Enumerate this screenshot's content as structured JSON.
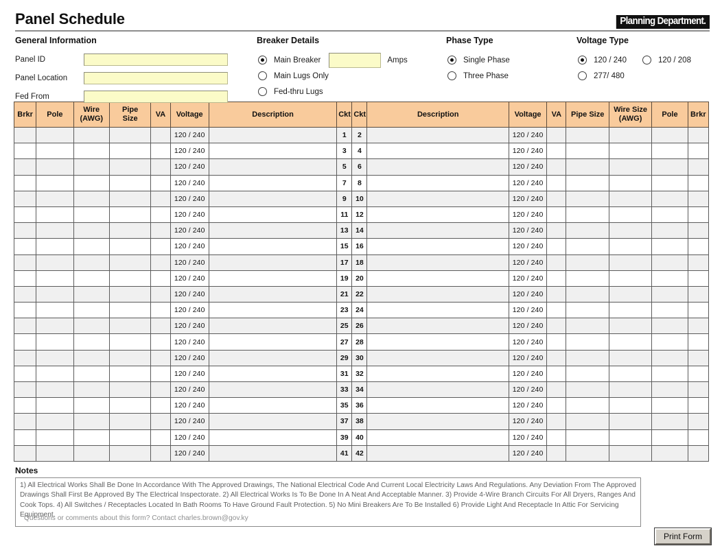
{
  "header": {
    "title": "Panel Schedule",
    "department_logo": "Planning Department."
  },
  "general_information": {
    "section_title": "General Information",
    "fields": [
      {
        "label": "Panel ID",
        "value": "",
        "placeholder": ""
      },
      {
        "label": "Panel Location",
        "value": "",
        "placeholder": ""
      },
      {
        "label": "Fed From",
        "value": "",
        "placeholder": ""
      }
    ]
  },
  "breaker_details": {
    "section_title": "Breaker Details",
    "options": [
      {
        "label": "Main Breaker",
        "selected": true
      },
      {
        "label": "Main Lugs Only",
        "selected": false
      },
      {
        "label": "Fed-thru Lugs",
        "selected": false
      }
    ],
    "amps_value": "",
    "amps_unit_label": "Amps"
  },
  "phase_type": {
    "section_title": "Phase Type",
    "options": [
      {
        "label": "Single Phase",
        "selected": true
      },
      {
        "label": "Three Phase",
        "selected": false
      }
    ]
  },
  "voltage_type": {
    "section_title": "Voltage Type",
    "options": [
      {
        "label": "120 / 240",
        "selected": true
      },
      {
        "label": "120 / 208",
        "selected": false
      },
      {
        "label": "277/ 480",
        "selected": false
      }
    ]
  },
  "schedule": {
    "columns": [
      "Brkr",
      "Pole",
      "Wire\n(AWG)",
      "Pipe\nSize",
      "VA",
      "Voltage",
      "Description",
      "Ckt",
      "Ckt",
      "Description",
      "Voltage",
      "VA",
      "Pipe Size",
      "Wire Size\n(AWG)",
      "Pole",
      "Brkr"
    ],
    "default_voltage": "120 / 240",
    "rows": [
      {
        "ckt_left": "1",
        "ckt_right": "2",
        "voltage_left": "120 / 240",
        "voltage_right": "120 / 240",
        "brkr_left": "",
        "pole_left": "",
        "wire_left": "",
        "pipe_left": "",
        "va_left": "",
        "desc_left": "",
        "desc_right": "",
        "va_right": "",
        "pipe_right": "",
        "wire_right": "",
        "pole_right": "",
        "brkr_right": ""
      },
      {
        "ckt_left": "3",
        "ckt_right": "4",
        "voltage_left": "120 / 240",
        "voltage_right": "120 / 240",
        "brkr_left": "",
        "pole_left": "",
        "wire_left": "",
        "pipe_left": "",
        "va_left": "",
        "desc_left": "",
        "desc_right": "",
        "va_right": "",
        "pipe_right": "",
        "wire_right": "",
        "pole_right": "",
        "brkr_right": ""
      },
      {
        "ckt_left": "5",
        "ckt_right": "6",
        "voltage_left": "120 / 240",
        "voltage_right": "120 / 240",
        "brkr_left": "",
        "pole_left": "",
        "wire_left": "",
        "pipe_left": "",
        "va_left": "",
        "desc_left": "",
        "desc_right": "",
        "va_right": "",
        "pipe_right": "",
        "wire_right": "",
        "pole_right": "",
        "brkr_right": ""
      },
      {
        "ckt_left": "7",
        "ckt_right": "8",
        "voltage_left": "120 / 240",
        "voltage_right": "120 / 240",
        "brkr_left": "",
        "pole_left": "",
        "wire_left": "",
        "pipe_left": "",
        "va_left": "",
        "desc_left": "",
        "desc_right": "",
        "va_right": "",
        "pipe_right": "",
        "wire_right": "",
        "pole_right": "",
        "brkr_right": ""
      },
      {
        "ckt_left": "9",
        "ckt_right": "10",
        "voltage_left": "120 / 240",
        "voltage_right": "120 / 240",
        "brkr_left": "",
        "pole_left": "",
        "wire_left": "",
        "pipe_left": "",
        "va_left": "",
        "desc_left": "",
        "desc_right": "",
        "va_right": "",
        "pipe_right": "",
        "wire_right": "",
        "pole_right": "",
        "brkr_right": ""
      },
      {
        "ckt_left": "11",
        "ckt_right": "12",
        "voltage_left": "120 / 240",
        "voltage_right": "120 / 240",
        "brkr_left": "",
        "pole_left": "",
        "wire_left": "",
        "pipe_left": "",
        "va_left": "",
        "desc_left": "",
        "desc_right": "",
        "va_right": "",
        "pipe_right": "",
        "wire_right": "",
        "pole_right": "",
        "brkr_right": ""
      },
      {
        "ckt_left": "13",
        "ckt_right": "14",
        "voltage_left": "120 / 240",
        "voltage_right": "120 / 240",
        "brkr_left": "",
        "pole_left": "",
        "wire_left": "",
        "pipe_left": "",
        "va_left": "",
        "desc_left": "",
        "desc_right": "",
        "va_right": "",
        "pipe_right": "",
        "wire_right": "",
        "pole_right": "",
        "brkr_right": ""
      },
      {
        "ckt_left": "15",
        "ckt_right": "16",
        "voltage_left": "120 / 240",
        "voltage_right": "120 / 240",
        "brkr_left": "",
        "pole_left": "",
        "wire_left": "",
        "pipe_left": "",
        "va_left": "",
        "desc_left": "",
        "desc_right": "",
        "va_right": "",
        "pipe_right": "",
        "wire_right": "",
        "pole_right": "",
        "brkr_right": ""
      },
      {
        "ckt_left": "17",
        "ckt_right": "18",
        "voltage_left": "120 / 240",
        "voltage_right": "120 / 240",
        "brkr_left": "",
        "pole_left": "",
        "wire_left": "",
        "pipe_left": "",
        "va_left": "",
        "desc_left": "",
        "desc_right": "",
        "va_right": "",
        "pipe_right": "",
        "wire_right": "",
        "pole_right": "",
        "brkr_right": ""
      },
      {
        "ckt_left": "19",
        "ckt_right": "20",
        "voltage_left": "120 / 240",
        "voltage_right": "120 / 240",
        "brkr_left": "",
        "pole_left": "",
        "wire_left": "",
        "pipe_left": "",
        "va_left": "",
        "desc_left": "",
        "desc_right": "",
        "va_right": "",
        "pipe_right": "",
        "wire_right": "",
        "pole_right": "",
        "brkr_right": ""
      },
      {
        "ckt_left": "21",
        "ckt_right": "22",
        "voltage_left": "120 / 240",
        "voltage_right": "120 / 240",
        "brkr_left": "",
        "pole_left": "",
        "wire_left": "",
        "pipe_left": "",
        "va_left": "",
        "desc_left": "",
        "desc_right": "",
        "va_right": "",
        "pipe_right": "",
        "wire_right": "",
        "pole_right": "",
        "brkr_right": ""
      },
      {
        "ckt_left": "23",
        "ckt_right": "24",
        "voltage_left": "120 / 240",
        "voltage_right": "120 / 240",
        "brkr_left": "",
        "pole_left": "",
        "wire_left": "",
        "pipe_left": "",
        "va_left": "",
        "desc_left": "",
        "desc_right": "",
        "va_right": "",
        "pipe_right": "",
        "wire_right": "",
        "pole_right": "",
        "brkr_right": ""
      },
      {
        "ckt_left": "25",
        "ckt_right": "26",
        "voltage_left": "120 / 240",
        "voltage_right": "120 / 240",
        "brkr_left": "",
        "pole_left": "",
        "wire_left": "",
        "pipe_left": "",
        "va_left": "",
        "desc_left": "",
        "desc_right": "",
        "va_right": "",
        "pipe_right": "",
        "wire_right": "",
        "pole_right": "",
        "brkr_right": ""
      },
      {
        "ckt_left": "27",
        "ckt_right": "28",
        "voltage_left": "120 / 240",
        "voltage_right": "120 / 240",
        "brkr_left": "",
        "pole_left": "",
        "wire_left": "",
        "pipe_left": "",
        "va_left": "",
        "desc_left": "",
        "desc_right": "",
        "va_right": "",
        "pipe_right": "",
        "wire_right": "",
        "pole_right": "",
        "brkr_right": ""
      },
      {
        "ckt_left": "29",
        "ckt_right": "30",
        "voltage_left": "120 / 240",
        "voltage_right": "120 / 240",
        "brkr_left": "",
        "pole_left": "",
        "wire_left": "",
        "pipe_left": "",
        "va_left": "",
        "desc_left": "",
        "desc_right": "",
        "va_right": "",
        "pipe_right": "",
        "wire_right": "",
        "pole_right": "",
        "brkr_right": ""
      },
      {
        "ckt_left": "31",
        "ckt_right": "32",
        "voltage_left": "120 / 240",
        "voltage_right": "120 / 240",
        "brkr_left": "",
        "pole_left": "",
        "wire_left": "",
        "pipe_left": "",
        "va_left": "",
        "desc_left": "",
        "desc_right": "",
        "va_right": "",
        "pipe_right": "",
        "wire_right": "",
        "pole_right": "",
        "brkr_right": ""
      },
      {
        "ckt_left": "33",
        "ckt_right": "34",
        "voltage_left": "120 / 240",
        "voltage_right": "120 / 240",
        "brkr_left": "",
        "pole_left": "",
        "wire_left": "",
        "pipe_left": "",
        "va_left": "",
        "desc_left": "",
        "desc_right": "",
        "va_right": "",
        "pipe_right": "",
        "wire_right": "",
        "pole_right": "",
        "brkr_right": ""
      },
      {
        "ckt_left": "35",
        "ckt_right": "36",
        "voltage_left": "120 / 240",
        "voltage_right": "120 / 240",
        "brkr_left": "",
        "pole_left": "",
        "wire_left": "",
        "pipe_left": "",
        "va_left": "",
        "desc_left": "",
        "desc_right": "",
        "va_right": "",
        "pipe_right": "",
        "wire_right": "",
        "pole_right": "",
        "brkr_right": ""
      },
      {
        "ckt_left": "37",
        "ckt_right": "38",
        "voltage_left": "120 / 240",
        "voltage_right": "120 / 240",
        "brkr_left": "",
        "pole_left": "",
        "wire_left": "",
        "pipe_left": "",
        "va_left": "",
        "desc_left": "",
        "desc_right": "",
        "va_right": "",
        "pipe_right": "",
        "wire_right": "",
        "pole_right": "",
        "brkr_right": ""
      },
      {
        "ckt_left": "39",
        "ckt_right": "40",
        "voltage_left": "120 / 240",
        "voltage_right": "120 / 240",
        "brkr_left": "",
        "pole_left": "",
        "wire_left": "",
        "pipe_left": "",
        "va_left": "",
        "desc_left": "",
        "desc_right": "",
        "va_right": "",
        "pipe_right": "",
        "wire_right": "",
        "pole_right": "",
        "brkr_right": ""
      },
      {
        "ckt_left": "41",
        "ckt_right": "42",
        "voltage_left": "120 / 240",
        "voltage_right": "120 / 240",
        "brkr_left": "",
        "pole_left": "",
        "wire_left": "",
        "pipe_left": "",
        "va_left": "",
        "desc_left": "",
        "desc_right": "",
        "va_right": "",
        "pipe_right": "",
        "wire_right": "",
        "pole_right": "",
        "brkr_right": ""
      }
    ]
  },
  "notes": {
    "heading": "Notes",
    "body": "1) All Electrical Works Shall Be Done In Accordance With The Approved Drawings, The National Electrical Code And Current Local Electricity Laws And Regulations. Any Deviation From The Approved Drawings Shall First Be Approved By The Electrical Inspectorate.  2) All Electrical Works Is To Be Done In A Neat And Acceptable Manner.  3) Provide 4-Wire Branch Circuits For All Dryers, Ranges And Cook Tops.  4) All Switches / Receptacles Located In Bath Rooms To Have Ground Fault Protection.   5) No Mini Breakers Are To Be Installed   6) Provide Light And Receptacle In Attic For Servicing Equipment.",
    "contact": "Questions or comments about this form? Contact charles.brown@gov.ky"
  },
  "actions": {
    "print_label": "Print Form"
  },
  "colors": {
    "table_header_bg": "#f9cb9c",
    "table_header_border": "#5b4b3c",
    "input_bg": "#fbfbc8",
    "row_stripe": "#f0f0f0",
    "logo_bg": "#111111",
    "notes_text": "#5f6061"
  }
}
